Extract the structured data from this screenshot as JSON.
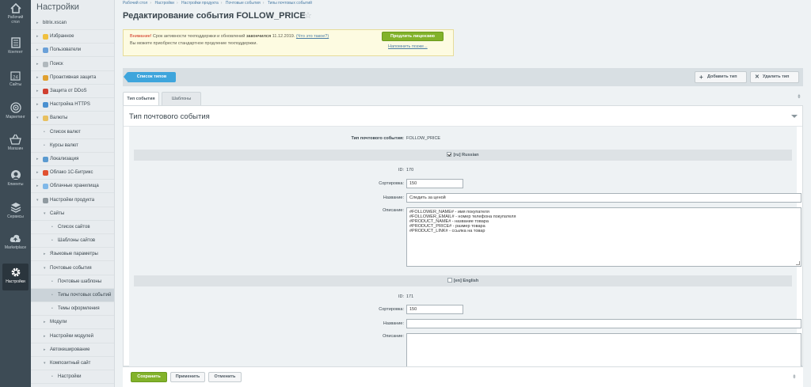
{
  "leftbar": [
    {
      "label1": "Рабочий",
      "label2": "стол",
      "icon": "home-icon"
    },
    {
      "label1": "Контент",
      "label2": "",
      "icon": "content-icon"
    },
    {
      "label1": "Сайты",
      "label2": "",
      "icon": "calendar-icon",
      "badge": "24"
    },
    {
      "label1": "Маркетинг",
      "label2": "",
      "icon": "target-icon"
    },
    {
      "label1": "Магазин",
      "label2": "",
      "icon": "basket-icon"
    },
    {
      "label1": "Клиенты",
      "label2": "",
      "icon": "clients-icon"
    },
    {
      "label1": "Сервисы",
      "label2": "",
      "icon": "layers-icon"
    },
    {
      "label1": "Marketplace",
      "label2": "",
      "icon": "cloud-upload-icon"
    },
    {
      "label1": "Настройки",
      "label2": "",
      "icon": "gear-icon"
    }
  ],
  "menu": {
    "title": "Настройки",
    "items": [
      "bitrix.xscan",
      "Избранное",
      "Пользователи",
      "Поиск",
      "Проактивная защита",
      "Защита от DDoS",
      "Настройка HTTPS",
      "Валюты",
      "Список валют",
      "Курсы валют",
      "Локализация",
      "Облако 1С-Битрикс",
      "Облачные хранилища",
      "Настройки продукта",
      "Сайты",
      "Список сайтов",
      "Шаблоны сайтов",
      "Языковые параметры",
      "Почтовые события",
      "Почтовые шаблоны",
      "Типы почтовых событий",
      "Темы оформления",
      "Модули",
      "Настройки модулей",
      "Автокеширование",
      "Композитный сайт",
      "Настройки"
    ]
  },
  "breadcrumbs": [
    "Рабочий стол",
    "Настройки",
    "Настройки продукта",
    "Почтовые события",
    "Типы почтовых событий"
  ],
  "page_title": "Редактирование события FOLLOW_PRICE",
  "warning": {
    "prefix": "Внимание!",
    "text1": " Срок активности техподдержки и обновлений ",
    "bold": "закончился",
    "text2": " 11.12.2019. ",
    "link": "(Что это такое?)",
    "line2": "Вы можете приобрести стандартное продление техподдержки.",
    "renew_button": "Продлить лицензию",
    "remind_link": "Напомнить позже..."
  },
  "toolbar": {
    "list_button": "Список типов",
    "add_button": "Добавить тип",
    "delete_button": "Удалить тип"
  },
  "tabs": [
    "Тип события",
    "Шаблоны"
  ],
  "panel": {
    "title": "Тип почтового события",
    "event_type_label": "Тип почтового события:",
    "event_type_value": "FOLLOW_PRICE",
    "ru": {
      "section": "[ru] Russian",
      "id_label": "ID:",
      "id_value": "170",
      "sort_label": "Сортировка:",
      "sort_value": "150",
      "name_label": "Название:",
      "name_value": "Следить за ценой",
      "desc_label": "Описание:",
      "desc_value": "#FOLLOWER_NAME# - имя покупателя\n#FOLLOWER_EMAIL# - номер телефона покупателя\n#PRODUCT_NAME# - название товара\n#PRODUCT_PRICE# - размер товара\n#PRODUCT_LINK# - ссылка на товар"
    },
    "en": {
      "section": "[en] English",
      "id_label": "ID:",
      "id_value": "171",
      "sort_label": "Сортировка:",
      "sort_value": "150",
      "name_label": "Название:",
      "name_value": "",
      "desc_label": "Описание:",
      "desc_value": ""
    }
  },
  "bottom": {
    "save": "Сохранить",
    "apply": "Применить",
    "cancel": "Отменить"
  },
  "colors": {
    "sidebar": "#3d4b55",
    "accent_blue": "#3ea5dc",
    "accent_green": "#82b22a",
    "warning_red": "#d0301d"
  }
}
